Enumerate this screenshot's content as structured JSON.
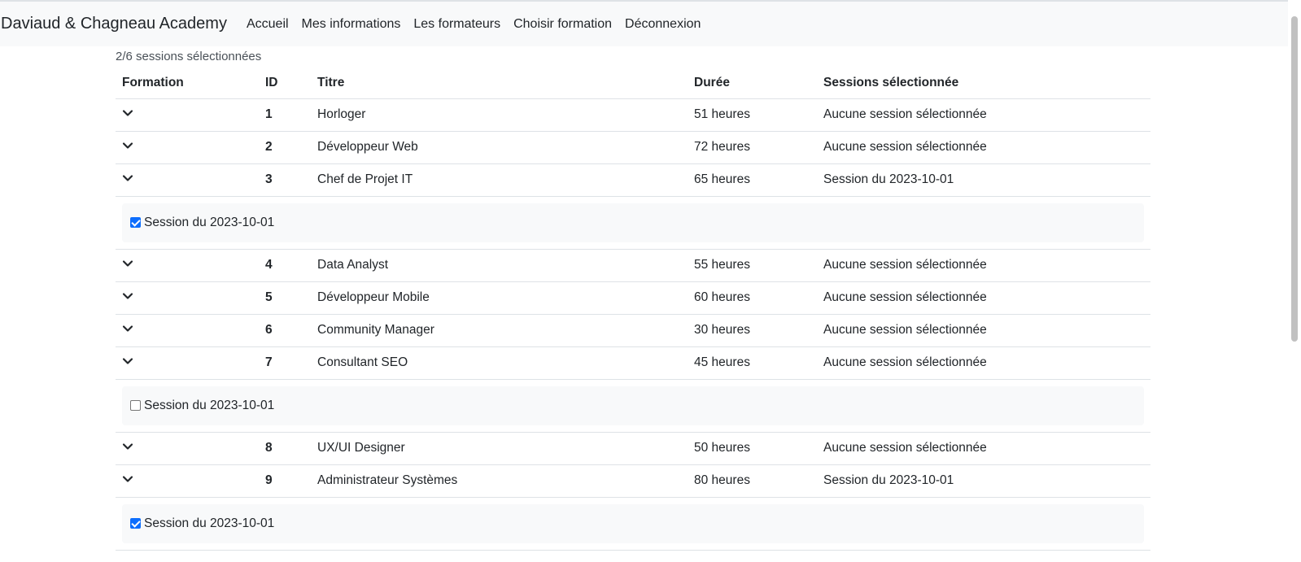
{
  "navbar": {
    "brand": "Daviaud & Chagneau Academy",
    "links": [
      "Accueil",
      "Mes informations",
      "Les formateurs",
      "Choisir formation",
      "Déconnexion"
    ]
  },
  "selected_count": "2/6 sessions sélectionnées",
  "table": {
    "headers": [
      "Formation",
      "ID",
      "Titre",
      "Durée",
      "Sessions sélectionnée"
    ],
    "rows": [
      {
        "id": "1",
        "titre": "Horloger",
        "duree": "51 heures",
        "sessions": "Aucune session sélectionnée"
      },
      {
        "id": "2",
        "titre": "Développeur Web",
        "duree": "72 heures",
        "sessions": "Aucune session sélectionnée"
      },
      {
        "id": "3",
        "titre": "Chef de Projet IT",
        "duree": "65 heures",
        "sessions": "Session du 2023-10-01",
        "detail": {
          "label": "Session du 2023-10-01",
          "checked": true
        }
      },
      {
        "id": "4",
        "titre": "Data Analyst",
        "duree": "55 heures",
        "sessions": "Aucune session sélectionnée"
      },
      {
        "id": "5",
        "titre": "Développeur Mobile",
        "duree": "60 heures",
        "sessions": "Aucune session sélectionnée"
      },
      {
        "id": "6",
        "titre": "Community Manager",
        "duree": "30 heures",
        "sessions": "Aucune session sélectionnée"
      },
      {
        "id": "7",
        "titre": "Consultant SEO",
        "duree": "45 heures",
        "sessions": "Aucune session sélectionnée",
        "detail": {
          "label": "Session du 2023-10-01",
          "checked": false
        }
      },
      {
        "id": "8",
        "titre": "UX/UI Designer",
        "duree": "50 heures",
        "sessions": "Aucune session sélectionnée"
      },
      {
        "id": "9",
        "titre": "Administrateur Systèmes",
        "duree": "80 heures",
        "sessions": "Session du 2023-10-01",
        "detail": {
          "label": "Session du 2023-10-01",
          "checked": true
        }
      }
    ]
  },
  "icons": {
    "expand": "chevron-down-icon"
  },
  "colors": {
    "navbar_bg": "#f8f9fa",
    "checkbox_checked": "#0d6efd",
    "border": "#dee2e6"
  }
}
